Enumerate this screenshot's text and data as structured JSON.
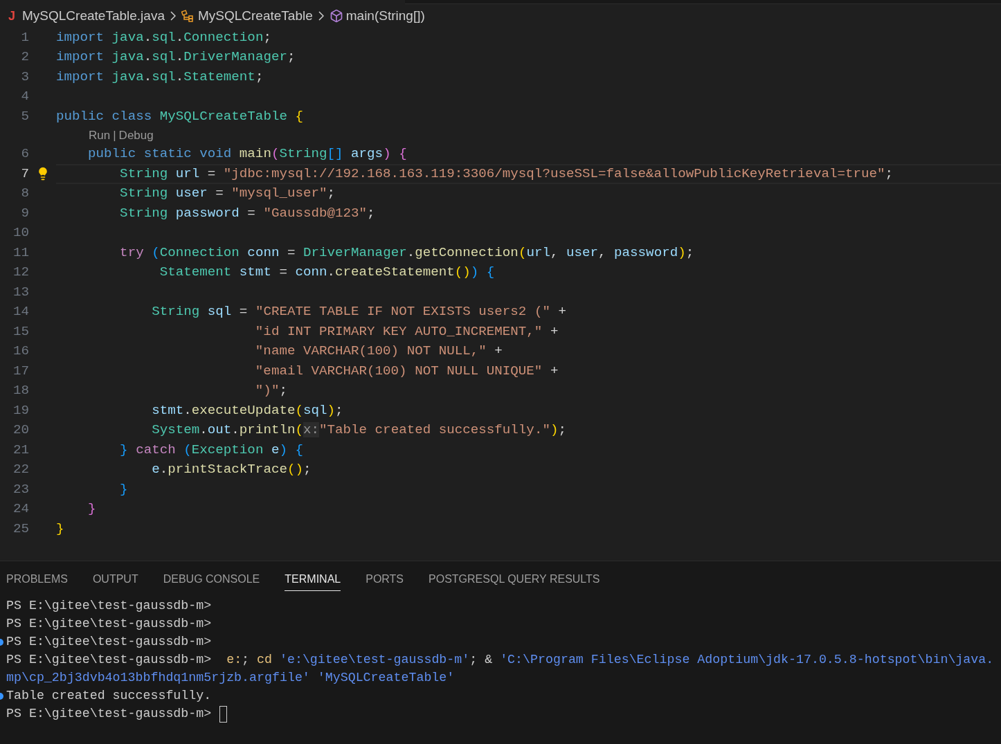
{
  "breadcrumb": {
    "file_icon": "J",
    "items": [
      {
        "kind": "file",
        "label": "MySQLCreateTable.java"
      },
      {
        "kind": "class",
        "label": "MySQLCreateTable"
      },
      {
        "kind": "method",
        "label": "main(String[])"
      }
    ]
  },
  "editor": {
    "lines": [
      {
        "kind": "code",
        "number": "1",
        "current": false,
        "lightbulb": false,
        "tokens": [
          {
            "text": "import",
            "kind": "keyword"
          },
          {
            "text": " java",
            "kind": "type"
          },
          {
            "text": ".",
            "kind": "plain"
          },
          {
            "text": "sql",
            "kind": "type"
          },
          {
            "text": ".",
            "kind": "plain"
          },
          {
            "text": "Connection",
            "kind": "type"
          },
          {
            "text": ";",
            "kind": "plain"
          }
        ]
      },
      {
        "kind": "code",
        "number": "2",
        "current": false,
        "lightbulb": false,
        "tokens": [
          {
            "text": "import",
            "kind": "keyword"
          },
          {
            "text": " java",
            "kind": "type"
          },
          {
            "text": ".",
            "kind": "plain"
          },
          {
            "text": "sql",
            "kind": "type"
          },
          {
            "text": ".",
            "kind": "plain"
          },
          {
            "text": "DriverManager",
            "kind": "type"
          },
          {
            "text": ";",
            "kind": "plain"
          }
        ]
      },
      {
        "kind": "code",
        "number": "3",
        "current": false,
        "lightbulb": false,
        "tokens": [
          {
            "text": "import",
            "kind": "keyword"
          },
          {
            "text": " java",
            "kind": "type"
          },
          {
            "text": ".",
            "kind": "plain"
          },
          {
            "text": "sql",
            "kind": "type"
          },
          {
            "text": ".",
            "kind": "plain"
          },
          {
            "text": "Statement",
            "kind": "type"
          },
          {
            "text": ";",
            "kind": "plain"
          }
        ]
      },
      {
        "kind": "code",
        "number": "4",
        "current": false,
        "lightbulb": false
      },
      {
        "kind": "code",
        "number": "5",
        "current": false,
        "lightbulb": false,
        "tokens": [
          {
            "text": "public class",
            "kind": "keyword"
          },
          {
            "text": " MySQLCreateTable",
            "kind": "type"
          },
          {
            "text": " {",
            "kind": "bracket1"
          }
        ]
      },
      {
        "kind": "codelens",
        "links": [
          "Run",
          "Debug"
        ],
        "separator": "|"
      },
      {
        "kind": "code",
        "number": "6",
        "current": false,
        "lightbulb": false,
        "tokens": [
          {
            "text": "    public static void",
            "kind": "keyword"
          },
          {
            "text": " main",
            "kind": "function"
          },
          {
            "text": "(",
            "kind": "bracket2"
          },
          {
            "text": "String",
            "kind": "type"
          },
          {
            "text": "[]",
            "kind": "bracket3"
          },
          {
            "text": " args",
            "kind": "variable"
          },
          {
            "text": ")",
            "kind": "bracket2"
          },
          {
            "text": " {",
            "kind": "bracket2"
          }
        ]
      },
      {
        "kind": "code",
        "number": "7",
        "current": true,
        "lightbulb": true,
        "tokens": [
          {
            "text": "        String",
            "kind": "type"
          },
          {
            "text": " url",
            "kind": "variable"
          },
          {
            "text": " = ",
            "kind": "plain"
          },
          {
            "text": "\"jdbc:mysql://192.168.163.119:3306/mysql?useSSL=false&allowPublicKeyRetrieval=true\"",
            "kind": "string"
          },
          {
            "text": ";",
            "kind": "plain"
          }
        ]
      },
      {
        "kind": "code",
        "number": "8",
        "current": false,
        "lightbulb": false,
        "tokens": [
          {
            "text": "        String",
            "kind": "type"
          },
          {
            "text": " user",
            "kind": "variable"
          },
          {
            "text": " = ",
            "kind": "plain"
          },
          {
            "text": "\"mysql_user\"",
            "kind": "string"
          },
          {
            "text": ";",
            "kind": "plain"
          }
        ]
      },
      {
        "kind": "code",
        "number": "9",
        "current": false,
        "lightbulb": false,
        "tokens": [
          {
            "text": "        String",
            "kind": "type"
          },
          {
            "text": " password",
            "kind": "variable"
          },
          {
            "text": " = ",
            "kind": "plain"
          },
          {
            "text": "\"Gaussdb@123\"",
            "kind": "string"
          },
          {
            "text": ";",
            "kind": "plain"
          }
        ]
      },
      {
        "kind": "code",
        "number": "10",
        "current": false,
        "lightbulb": false
      },
      {
        "kind": "code",
        "number": "11",
        "current": false,
        "lightbulb": false,
        "tokens": [
          {
            "text": "        try",
            "kind": "control"
          },
          {
            "text": " (",
            "kind": "bracket3"
          },
          {
            "text": "Connection",
            "kind": "type"
          },
          {
            "text": " conn",
            "kind": "variable"
          },
          {
            "text": " = ",
            "kind": "plain"
          },
          {
            "text": "DriverManager",
            "kind": "type"
          },
          {
            "text": ".",
            "kind": "plain"
          },
          {
            "text": "getConnection",
            "kind": "function"
          },
          {
            "text": "(",
            "kind": "bracket1"
          },
          {
            "text": "url",
            "kind": "variable"
          },
          {
            "text": ", ",
            "kind": "plain"
          },
          {
            "text": "user",
            "kind": "variable"
          },
          {
            "text": ", ",
            "kind": "plain"
          },
          {
            "text": "password",
            "kind": "variable"
          },
          {
            "text": ")",
            "kind": "bracket1"
          },
          {
            "text": ";",
            "kind": "plain"
          }
        ]
      },
      {
        "kind": "code",
        "number": "12",
        "current": false,
        "lightbulb": false,
        "tokens": [
          {
            "text": "             Statement",
            "kind": "type"
          },
          {
            "text": " stmt",
            "kind": "variable"
          },
          {
            "text": " = ",
            "kind": "plain"
          },
          {
            "text": "conn",
            "kind": "variable"
          },
          {
            "text": ".",
            "kind": "plain"
          },
          {
            "text": "createStatement",
            "kind": "function"
          },
          {
            "text": "()",
            "kind": "bracket1"
          },
          {
            "text": ")",
            "kind": "bracket3"
          },
          {
            "text": " {",
            "kind": "bracket3"
          }
        ]
      },
      {
        "kind": "code",
        "number": "13",
        "current": false,
        "lightbulb": false
      },
      {
        "kind": "code",
        "number": "14",
        "current": false,
        "lightbulb": false,
        "tokens": [
          {
            "text": "            String",
            "kind": "type"
          },
          {
            "text": " sql",
            "kind": "variable"
          },
          {
            "text": " = ",
            "kind": "plain"
          },
          {
            "text": "\"CREATE TABLE IF NOT EXISTS users2 (\"",
            "kind": "string"
          },
          {
            "text": " +",
            "kind": "plain"
          }
        ]
      },
      {
        "kind": "code",
        "number": "15",
        "current": false,
        "lightbulb": false,
        "tokens": [
          {
            "text": "                         \"id INT PRIMARY KEY AUTO_INCREMENT,\"",
            "kind": "string"
          },
          {
            "text": " +",
            "kind": "plain"
          }
        ]
      },
      {
        "kind": "code",
        "number": "16",
        "current": false,
        "lightbulb": false,
        "tokens": [
          {
            "text": "                         \"name VARCHAR(100) NOT NULL,\"",
            "kind": "string"
          },
          {
            "text": " +",
            "kind": "plain"
          }
        ]
      },
      {
        "kind": "code",
        "number": "17",
        "current": false,
        "lightbulb": false,
        "tokens": [
          {
            "text": "                         \"email VARCHAR(100) NOT NULL UNIQUE\"",
            "kind": "string"
          },
          {
            "text": " +",
            "kind": "plain"
          }
        ]
      },
      {
        "kind": "code",
        "number": "18",
        "current": false,
        "lightbulb": false,
        "tokens": [
          {
            "text": "                         \")\"",
            "kind": "string"
          },
          {
            "text": ";",
            "kind": "plain"
          }
        ]
      },
      {
        "kind": "code",
        "number": "19",
        "current": false,
        "lightbulb": false,
        "tokens": [
          {
            "text": "            stmt",
            "kind": "variable"
          },
          {
            "text": ".",
            "kind": "plain"
          },
          {
            "text": "executeUpdate",
            "kind": "function"
          },
          {
            "text": "(",
            "kind": "bracket1"
          },
          {
            "text": "sql",
            "kind": "variable"
          },
          {
            "text": ")",
            "kind": "bracket1"
          },
          {
            "text": ";",
            "kind": "plain"
          }
        ]
      },
      {
        "kind": "code",
        "number": "20",
        "current": false,
        "lightbulb": false,
        "tokens": [
          {
            "text": "            System",
            "kind": "type"
          },
          {
            "text": ".",
            "kind": "plain"
          },
          {
            "text": "out",
            "kind": "variable"
          },
          {
            "text": ".",
            "kind": "plain"
          },
          {
            "text": "println",
            "kind": "function"
          },
          {
            "text": "(",
            "kind": "bracket1"
          },
          {
            "text": "x:",
            "kind": "hint"
          },
          {
            "text": "\"Table created successfully.\"",
            "kind": "string"
          },
          {
            "text": ")",
            "kind": "bracket1"
          },
          {
            "text": ";",
            "kind": "plain"
          }
        ]
      },
      {
        "kind": "code",
        "number": "21",
        "current": false,
        "lightbulb": false,
        "tokens": [
          {
            "text": "        }",
            "kind": "bracket3"
          },
          {
            "text": " catch",
            "kind": "control"
          },
          {
            "text": " (",
            "kind": "bracket3"
          },
          {
            "text": "Exception",
            "kind": "type"
          },
          {
            "text": " e",
            "kind": "variable"
          },
          {
            "text": ")",
            "kind": "bracket3"
          },
          {
            "text": " {",
            "kind": "bracket3"
          }
        ]
      },
      {
        "kind": "code",
        "number": "22",
        "current": false,
        "lightbulb": false,
        "tokens": [
          {
            "text": "            e",
            "kind": "variable"
          },
          {
            "text": ".",
            "kind": "plain"
          },
          {
            "text": "printStackTrace",
            "kind": "function"
          },
          {
            "text": "()",
            "kind": "bracket1"
          },
          {
            "text": ";",
            "kind": "plain"
          }
        ]
      },
      {
        "kind": "code",
        "number": "23",
        "current": false,
        "lightbulb": false,
        "tokens": [
          {
            "text": "        }",
            "kind": "bracket3"
          }
        ]
      },
      {
        "kind": "code",
        "number": "24",
        "current": false,
        "lightbulb": false,
        "tokens": [
          {
            "text": "    }",
            "kind": "bracket2"
          }
        ]
      },
      {
        "kind": "code",
        "number": "25",
        "current": false,
        "lightbulb": false,
        "tokens": [
          {
            "text": "}",
            "kind": "bracket1"
          }
        ]
      }
    ]
  },
  "panel": {
    "tabs": [
      {
        "label": "PROBLEMS",
        "selected": false
      },
      {
        "label": "OUTPUT",
        "selected": false
      },
      {
        "label": "DEBUG CONSOLE",
        "selected": false
      },
      {
        "label": "TERMINAL",
        "selected": true
      },
      {
        "label": "PORTS",
        "selected": false
      },
      {
        "label": "POSTGRESQL QUERY RESULTS",
        "selected": false
      }
    ],
    "terminal": [
      {
        "decorated": false,
        "cursor": false,
        "tokens": [
          {
            "text": "PS E:\\gitee\\test-gaussdb-m>",
            "kind": "plain"
          }
        ]
      },
      {
        "decorated": false,
        "cursor": false,
        "tokens": [
          {
            "text": "PS E:\\gitee\\test-gaussdb-m>",
            "kind": "plain"
          }
        ]
      },
      {
        "decorated": true,
        "cursor": false,
        "tokens": [
          {
            "text": "PS E:\\gitee\\test-gaussdb-m>",
            "kind": "plain"
          }
        ]
      },
      {
        "decorated": false,
        "cursor": false,
        "tokens": [
          {
            "text": "PS E:\\gitee\\test-gaussdb-m>",
            "kind": "plain"
          },
          {
            "text": "  e:",
            "kind": "command"
          },
          {
            "text": "; ",
            "kind": "plain"
          },
          {
            "text": "cd",
            "kind": "command"
          },
          {
            "text": " 'e:\\gitee\\test-gaussdb-m'",
            "kind": "string"
          },
          {
            "text": "; & ",
            "kind": "plain"
          },
          {
            "text": "'C:\\Program Files\\Eclipse Adoptium\\jdk-17.0.5.8-hotspot\\bin\\java.",
            "kind": "string"
          }
        ]
      },
      {
        "decorated": false,
        "cursor": false,
        "tokens": [
          {
            "text": "mp\\cp_2bj3dvb4o13bbfhdq1nm5rjzb.argfile' 'MySQLCreateTable'",
            "kind": "string"
          }
        ]
      },
      {
        "decorated": true,
        "cursor": false,
        "tokens": [
          {
            "text": "Table created successfully.",
            "kind": "plain"
          }
        ]
      },
      {
        "decorated": false,
        "cursor": true,
        "tokens": [
          {
            "text": "PS E:\\gitee\\test-gaussdb-m>",
            "kind": "plain"
          }
        ]
      }
    ]
  }
}
